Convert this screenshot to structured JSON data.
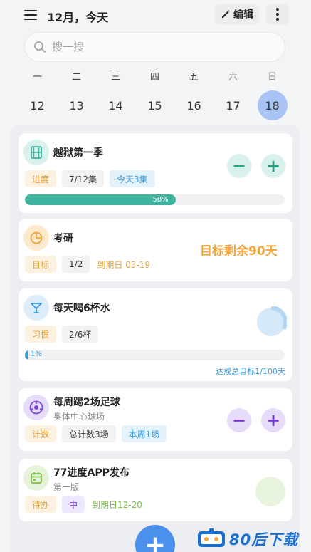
{
  "header": {
    "title": "12月，今天",
    "edit_label": "编辑"
  },
  "search": {
    "placeholder": "搜一搜"
  },
  "calendar": {
    "weekdays": [
      "一",
      "二",
      "三",
      "四",
      "五",
      "六",
      "日"
    ],
    "days": [
      "12",
      "13",
      "14",
      "15",
      "16",
      "17",
      "18"
    ],
    "selected_index": 6
  },
  "cards": [
    {
      "title": "越狱第一季",
      "tags": [
        "进度",
        "7/12集",
        "今天3集"
      ],
      "progress_pct": 58,
      "progress_label": "58%",
      "color": "#3fb39d"
    },
    {
      "title": "考研",
      "tags": [
        "目标",
        "1/2",
        "到期日 03-19"
      ],
      "highlight": "目标剩余90天",
      "color": "#f0a53c"
    },
    {
      "title": "每天喝6杯水",
      "tags": [
        "习惯",
        "2/6杯"
      ],
      "progress_pct": 1,
      "progress_label": "1%",
      "footer": "达成总目标1/100天",
      "color": "#3a9ad9"
    },
    {
      "title": "每周踢2场足球",
      "subtitle": "奥体中心球场",
      "tags": [
        "计数",
        "总计数3场",
        "本周1场"
      ],
      "color": "#7a45d8"
    },
    {
      "title": "77进度APP发布",
      "subtitle": "第一版",
      "tags": [
        "待办",
        "中",
        "到期日12-20"
      ],
      "color": "#7bbf4a"
    }
  ],
  "watermark": {
    "text": "80后下载"
  }
}
